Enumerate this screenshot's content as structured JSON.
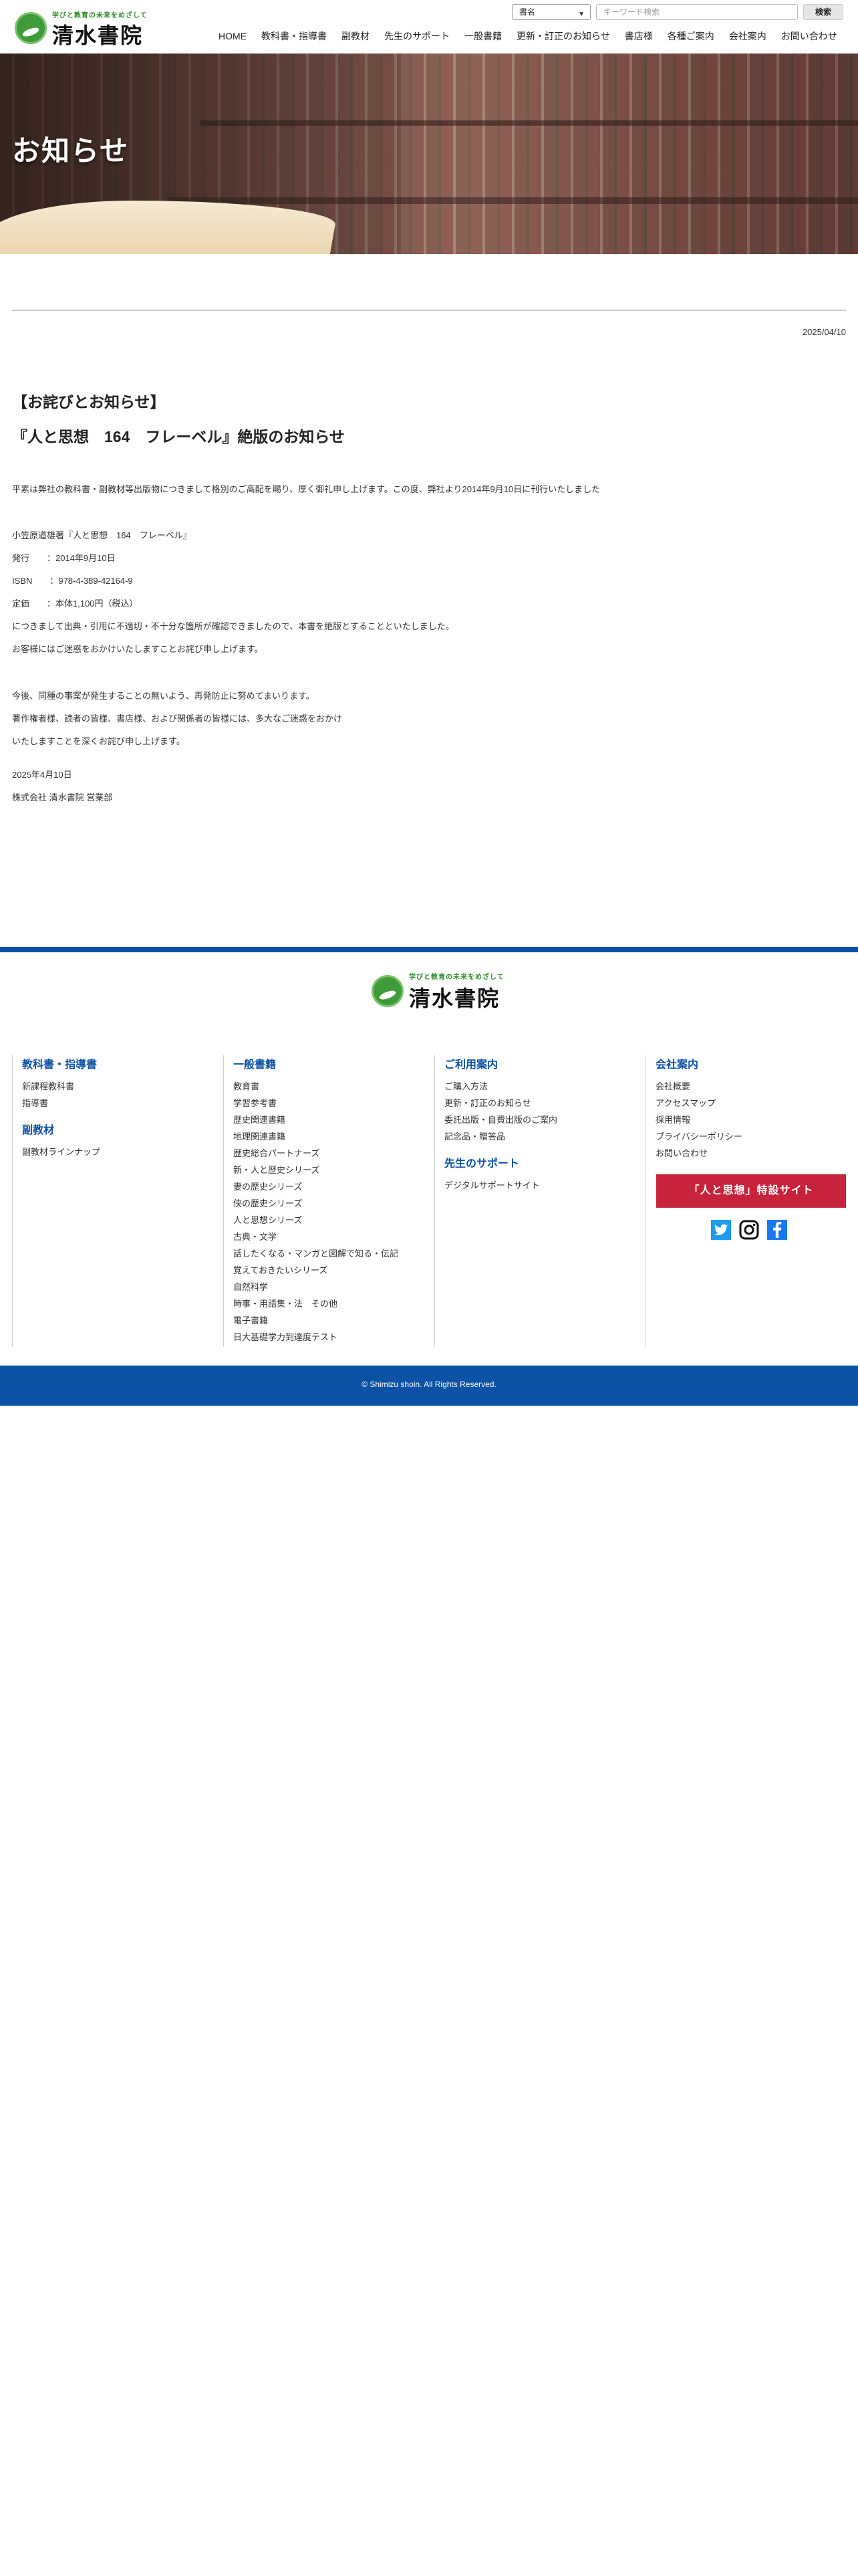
{
  "header": {
    "logo_tagline": "学びと教育の未来をめざして",
    "logo_name": "清水書院",
    "search": {
      "category_selected": "書名",
      "placeholder": "キーワード検索",
      "button_label": "検索"
    },
    "nav": [
      "HOME",
      "教科書・指導書",
      "副教材",
      "先生のサポート",
      "一般書籍",
      "更新・訂正のお知らせ",
      "書店様",
      "各種ご案内",
      "会社案内",
      "お問い合わせ"
    ]
  },
  "hero": {
    "title": "お知らせ"
  },
  "article": {
    "date": "2025/04/10",
    "title_line1": "【お詫びとお知らせ】",
    "title_line2": "『人と思想　164　フレーベル』絶版のお知らせ",
    "intro": "平素は弊社の教科書・副教材等出版物につきまして格別のご高配を賜り、厚く御礼申し上げます。この度、弊社より2014年9月10日に刊行いたしました",
    "book_line": "小笠原道雄著『人と思想　164　フレーベル』",
    "issue_line": "発行　　：2014年9月10日",
    "isbn_line": "ISBN　　：978-4-389-42164-9",
    "price_line": "定価　　：本体1,100円（税込）",
    "reason_line": "につきまして出典・引用に不適切・不十分な箇所が確認できましたので、本書を絶版とすることといたしました。",
    "apology_line": "お客様にはご迷惑をおかけいたしますことお詫び申し上げます。",
    "prevention_line": "今後、同種の事案が発生することの無いよう、再発防止に努めてまいります。",
    "closing_line1": "著作権者様、読者の皆様、書店様、および関係者の皆様には、多大なご迷惑をおかけ",
    "closing_line2": "いたしますことを深くお詫び申し上げます。",
    "sign_date": "2025年4月10日",
    "sign_company": "株式会社 清水書院 営業部"
  },
  "footer": {
    "logo_tagline": "学びと教育の未来をめざして",
    "logo_name": "清水書院",
    "col1": {
      "heading1": "教科書・指導書",
      "links1": [
        "新課程教科書",
        "指導書"
      ],
      "heading2": "副教材",
      "links2": [
        "副教材ラインナップ"
      ]
    },
    "col2": {
      "heading": "一般書籍",
      "links": [
        "教育書",
        "学習参考書",
        "歴史関連書籍",
        "地理関連書籍",
        "歴史総合パートナーズ",
        "新・人と歴史シリーズ",
        "妻の歴史シリーズ",
        "侠の歴史シリーズ",
        "人と思想シリーズ",
        "古典・文学",
        "話したくなる・マンガと図解で知る・伝記",
        "覚えておきたいシリーズ",
        "自然科学",
        "時事・用語集・法　その他",
        "電子書籍",
        "日大基礎学力到達度テスト"
      ]
    },
    "col3": {
      "heading1": "ご利用案内",
      "links1": [
        "ご購入方法",
        "更新・訂正のお知らせ",
        "委託出版・自費出版のご案内",
        "記念品・贈答品"
      ],
      "heading2": "先生のサポート",
      "links2": [
        "デジタルサポートサイト"
      ]
    },
    "col4": {
      "heading": "会社案内",
      "links": [
        "会社概要",
        "アクセスマップ",
        "採用情報",
        "プライバシーポリシー",
        "お問い合わせ"
      ],
      "special_button": "「人と思想」特設サイト"
    },
    "sns": [
      "twitter-icon",
      "instagram-icon",
      "facebook-icon"
    ],
    "copyright": "© Shimizu shoin. All Rights Reserved."
  },
  "colors": {
    "brand_blue": "#0b51a5",
    "brand_green": "#3f9a3a",
    "special_red": "#c8233c"
  }
}
